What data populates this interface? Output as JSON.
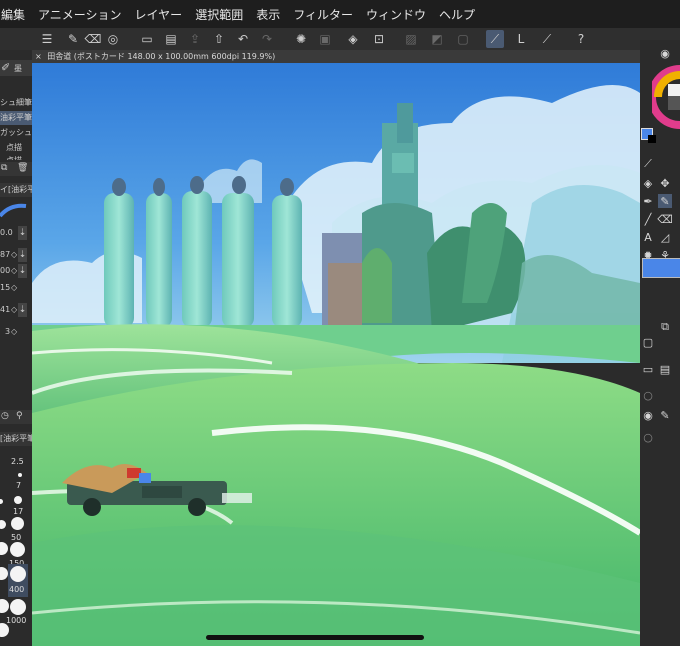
{
  "menu": {
    "items": [
      "編集",
      "アニメーション",
      "レイヤー",
      "選択範囲",
      "表示",
      "フィルター",
      "ウィンドウ",
      "ヘルプ"
    ]
  },
  "tab": {
    "close": "×",
    "title": "田舎道 (ポストカード 148.00 x 100.00mm 600dpi 119.9%)"
  },
  "left_panel": {
    "subtool_header": "墨",
    "subtools": [
      "シュ細筆",
      "油彩平筆",
      "ガッシュ",
      "点描",
      "点描"
    ],
    "brush_name": "イ[油彩平",
    "values": [
      "0.0",
      "87",
      "00",
      "15",
      "41",
      "3"
    ],
    "brush_size_header": "[油彩平筆]",
    "brush_sizes": [
      "2.5",
      "7",
      "17",
      "50",
      "150",
      "400",
      "1000"
    ]
  },
  "colors": {
    "accent": "#4a86e8",
    "main_color": "#4a86e8"
  }
}
